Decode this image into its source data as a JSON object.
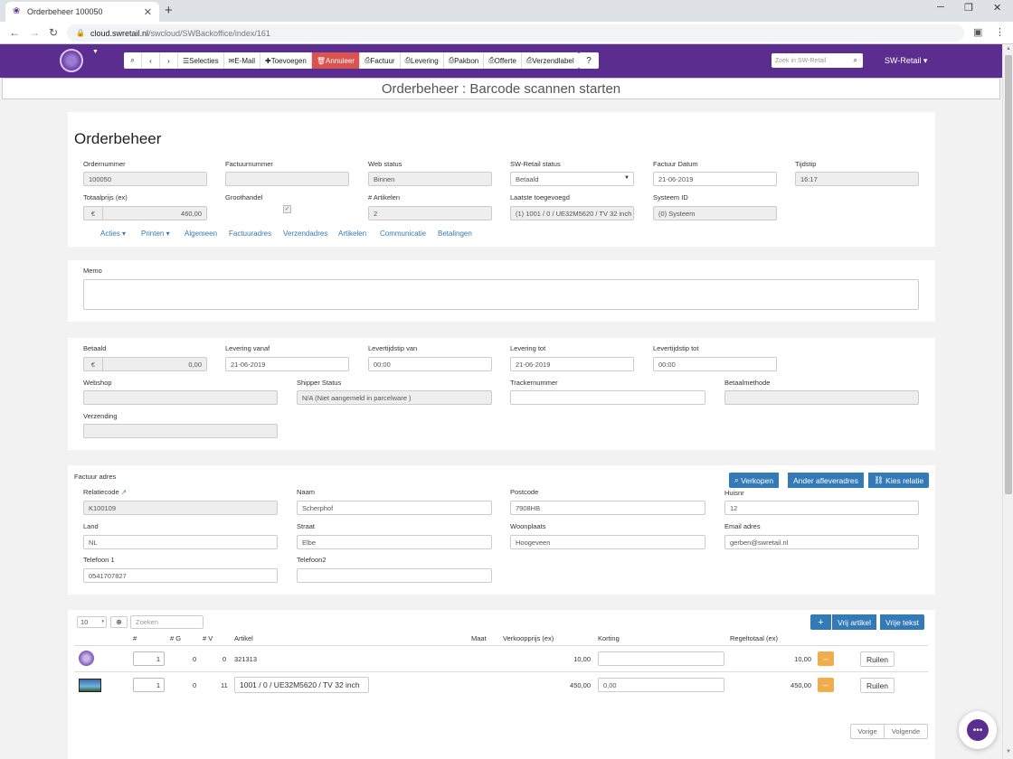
{
  "browser": {
    "tab_title": "Orderbeheer 100050",
    "url_host": "cloud.swretail.nl",
    "url_path": "/swcloud/SWBackoffice/index/161"
  },
  "toolbar": {
    "selecties": "Selecties",
    "email": "E-Mail",
    "toevoegen": "Toevoegen",
    "annuleer": "Annuleer",
    "factuur": "Factuur",
    "levering": "Levering",
    "pakbon": "Pakbon",
    "offerte": "Offerte",
    "verzendlabel": "Verzendlabel"
  },
  "app": {
    "search_placeholder": "Zoek in SW-Retail",
    "user_menu": "SW-Retail",
    "page_title": "Orderbeheer : Barcode scannen starten"
  },
  "order": {
    "heading": "Orderbeheer",
    "labels": {
      "ordernummer": "Ordernummer",
      "factuurnummer": "Factuurnummer",
      "web_status": "Web status",
      "sw_status": "SW-Retail status",
      "factuur_datum": "Factuur Datum",
      "tijdstip": "Tijdstip",
      "totaalprijs": "Totaalprijs (ex)",
      "groothandel": "Groothandel",
      "artikelen": "# Artikelen",
      "laatste": "Laatste toegevoegd",
      "systeem_id": "Systeem ID"
    },
    "values": {
      "ordernummer": "100050",
      "factuurnummer": "",
      "web_status": "Binnen",
      "sw_status": "Betaald",
      "factuur_datum": "21-06-2019",
      "tijdstip": "16:17",
      "currency": "€",
      "totaalprijs": "460,00",
      "artikelen": "2",
      "laatste": "(1) 1001 / 0 / UE32M5620  / TV 32 inch",
      "systeem_id": "(0) Systeem"
    },
    "nav": {
      "acties": "Acties",
      "printen": "Printen",
      "algemeen": "Algemeen",
      "factuuradres": "Factuuradres",
      "verzendadres": "Verzendadres",
      "artikelen": "Artikelen",
      "communicatie": "Communicatie",
      "betalingen": "Betalingen"
    }
  },
  "memo": {
    "label": "Memo",
    "value": ""
  },
  "delivery": {
    "labels": {
      "betaald": "Betaald",
      "levering_vanaf": "Levering vanaf",
      "levertijd_van": "Levertijdstip van",
      "levering_tot": "Levering tot",
      "levertijd_tot": "Levertijdstip tot",
      "webshop": "Webshop",
      "shipper_status": "Shipper Status",
      "trackernummer": "Trackernummer",
      "betaalmethode": "Betaalmethode",
      "verzending": "Verzending"
    },
    "values": {
      "betaald": "0,00",
      "levering_vanaf": "21-06-2019",
      "levertijd_van": "00:00",
      "levering_tot": "21-06-2019",
      "levertijd_tot": "00:00",
      "webshop": "",
      "shipper_status": "N/A (Niet aangemeld in parcelware )",
      "trackernummer": "",
      "betaalmethode": "",
      "verzending": ""
    }
  },
  "invoice_address": {
    "title": "Factuur adres",
    "buttons": {
      "verkopen": "Verkopen",
      "ander": "Ander afleveradres",
      "kies": "Kies relatie"
    },
    "labels": {
      "relatiecode": "Relatiecode",
      "naam": "Naam",
      "postcode": "Postcode",
      "huisnr": "Huisnr",
      "land": "Land",
      "straat": "Straat",
      "woonplaats": "Woonplaats",
      "email": "Email adres",
      "telefoon1": "Telefoon 1",
      "telefoon2": "Telefoon2"
    },
    "values": {
      "relatiecode": "K100109",
      "naam": "Scherphof",
      "postcode": "7908HB",
      "huisnr": "12",
      "land": "NL",
      "straat": "Elbe",
      "woonplaats": "Hoogeveen",
      "email": "gerben@swretail.nl",
      "telefoon1": "0541707827",
      "telefoon2": ""
    }
  },
  "articles": {
    "page_size": "10",
    "search_placeholder": "Zoeken",
    "buttons": {
      "vrij_artikel": "Vrij artikel",
      "vrije_tekst": "Vrije tekst"
    },
    "headers": {
      "nr": "#",
      "g": "# G",
      "v": "# V",
      "artikel": "Artikel",
      "maat": "Maat",
      "prijs": "Verkoopprijs (ex)",
      "korting": "Korting",
      "regeltotaal": "Regeltotaal (ex)"
    },
    "rows": [
      {
        "qty": "1",
        "g": "0",
        "v": "0",
        "artikel": "321313",
        "prijs": "10,00",
        "korting": "",
        "totaal": "10,00",
        "minus": "–",
        "ruilen": "Ruilen"
      },
      {
        "qty": "1",
        "g": "0",
        "v": "11",
        "artikel": "1001 / 0 / UE32M5620 / TV 32 inch",
        "prijs": "450,00",
        "korting": "0,00",
        "totaal": "450,00",
        "minus": "–",
        "ruilen": "Ruilen"
      }
    ],
    "pager": {
      "prev": "Vorige",
      "next": "Volgende"
    }
  }
}
